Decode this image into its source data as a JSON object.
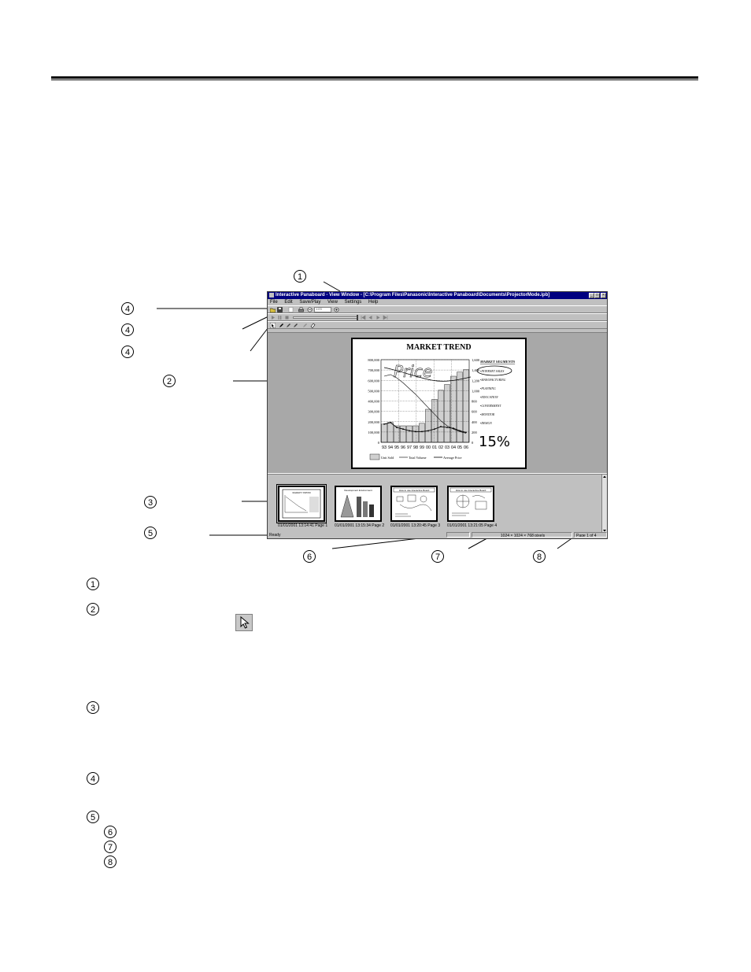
{
  "window": {
    "title": "Interactive Panaboard - View Window - [C:\\Program Files\\Panasonic\\Interactive Panaboard\\Documents\\ProjectorMode.ipb]",
    "menu": [
      "File",
      "Edit",
      "Save/Play",
      "View",
      "Settings",
      "Help"
    ],
    "zoom_value": "100"
  },
  "page_chart": {
    "title": "MARKET TREND",
    "y_ticks_left": [
      "800,000",
      "700,000",
      "600,000",
      "500,000",
      "400,000",
      "300,000",
      "200,000",
      "100,000",
      "0"
    ],
    "y_ticks_right": [
      "1,600",
      "1,400",
      "1,200",
      "1,000",
      "800",
      "600",
      "400",
      "200",
      "0"
    ],
    "x_ticks": [
      "93",
      "94",
      "95",
      "96",
      "97",
      "98",
      "99",
      "00",
      "01",
      "02",
      "03",
      "04",
      "05",
      "06"
    ],
    "legend": [
      "Unit Sold",
      "Total Volume",
      "Average Price"
    ],
    "segments_title": "MARKET SEGMENTS",
    "segments": [
      "•INTERNET SALES",
      "•MANUFACTURING",
      "•PLANNING",
      "•EDUCATION",
      "•GOVERNMENT",
      "•MONITOR",
      "•DESIGN"
    ],
    "handwriting_price": "Price",
    "handwriting_pct": "15%",
    "bars": [
      0.22,
      0.24,
      0.2,
      0.2,
      0.2,
      0.2,
      0.23,
      0.4,
      0.52,
      0.63,
      0.7,
      0.8,
      0.85,
      0.88
    ]
  },
  "thumbnails": [
    {
      "caption": "01/01/2001 13:14:41  Page 1"
    },
    {
      "caption": "01/01/2001 13:15:34  Page 2"
    },
    {
      "caption": "01/01/2001 13:20:45  Page 3"
    },
    {
      "caption": "01/01/2001 13:21:05  Page 4"
    }
  ],
  "thumb_titles": [
    "MARKET TREND",
    "Development Environment",
    "How to use Interactive Board",
    "How to use Interactive Board"
  ],
  "status": {
    "ready": "Ready",
    "resolution": "1024 × 1024 × 768 pixels",
    "page": "Page 1 of 4"
  },
  "callouts": {
    "c1": "1",
    "c2": "2",
    "c3": "3",
    "c4": "4",
    "c5": "5",
    "c6": "6",
    "c7": "7",
    "c8": "8"
  }
}
